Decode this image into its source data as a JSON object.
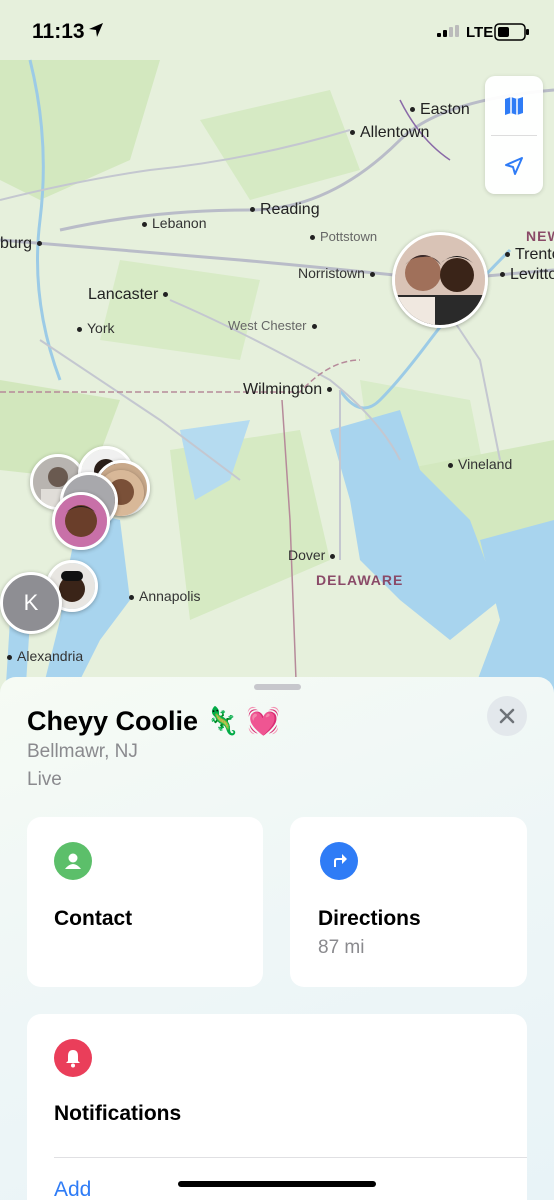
{
  "status_bar": {
    "time": "11:13",
    "network": "LTE"
  },
  "map": {
    "labels": {
      "easton": "Easton",
      "allentown": "Allentown",
      "lebanon": "Lebanon",
      "reading": "Reading",
      "pottstown": "Pottstown",
      "norristown": "Norristown",
      "trenton": "Trento",
      "levittown": "Levittow",
      "new_jersey": "NEW",
      "harrisburg": "burg",
      "lancaster": "Lancaster",
      "york": "York",
      "west_chester": "West Chester",
      "wilmington": "Wilmington",
      "vineland": "Vineland",
      "dover": "Dover",
      "delaware": "DELAWARE",
      "annapolis": "Annapolis",
      "alexandria": "Alexandria"
    },
    "avatar_initial": "K"
  },
  "person": {
    "name": "Cheyy Coolie 🦎 💓",
    "location": "Bellmawr, NJ",
    "status": "Live"
  },
  "actions": {
    "contact_label": "Contact",
    "directions_label": "Directions",
    "directions_distance": "87 mi"
  },
  "notifications": {
    "title": "Notifications",
    "add_label": "Add"
  },
  "colors": {
    "accent": "#2f7cf6",
    "contact_icon": "#5cbf6a",
    "directions_icon": "#2f7cf6",
    "notifications_icon": "#ea3e5a",
    "water": "#a8d4ee",
    "land": "#d8ecc8"
  }
}
